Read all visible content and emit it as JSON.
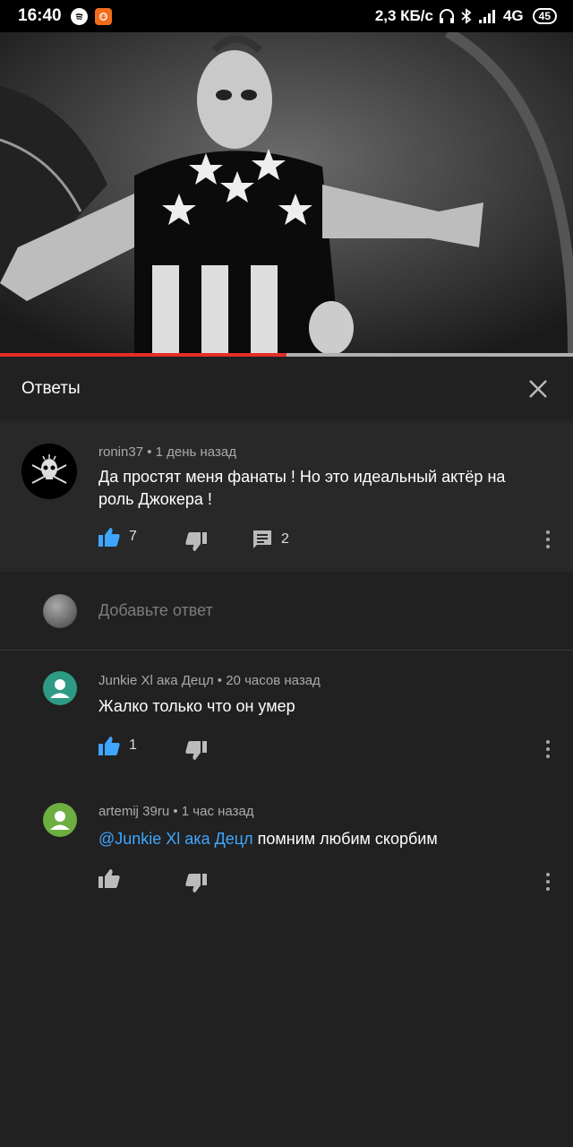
{
  "status_bar": {
    "time": "16:40",
    "net_speed": "2,3 КБ/с",
    "network": "4G",
    "battery": "45"
  },
  "video": {
    "progress_fraction": 0.5
  },
  "replies": {
    "title": "Ответы"
  },
  "parent_comment": {
    "author": "ronin37",
    "time": "1 день назад",
    "text": "Да простят меня фанаты ! Но это идеальный актёр на роль Джокера !",
    "likes": "7",
    "replies": "2"
  },
  "add_reply": {
    "placeholder": "Добавьте ответ"
  },
  "replies_list": [
    {
      "author": "Junkie Xl ака Децл",
      "time": "20 часов назад",
      "text": "Жалко только что он умер",
      "likes": "1",
      "avatar_color": "#2e9a83"
    },
    {
      "author": "artemij 39ru",
      "time": "1 час назад",
      "mention": "@Junkie Xl ака Децл",
      "text": "помним любим скорбим",
      "avatar_color": "#6cae3f"
    }
  ],
  "colors": {
    "accent_blue": "#3ea6ff",
    "progress_red": "#e52d27"
  }
}
